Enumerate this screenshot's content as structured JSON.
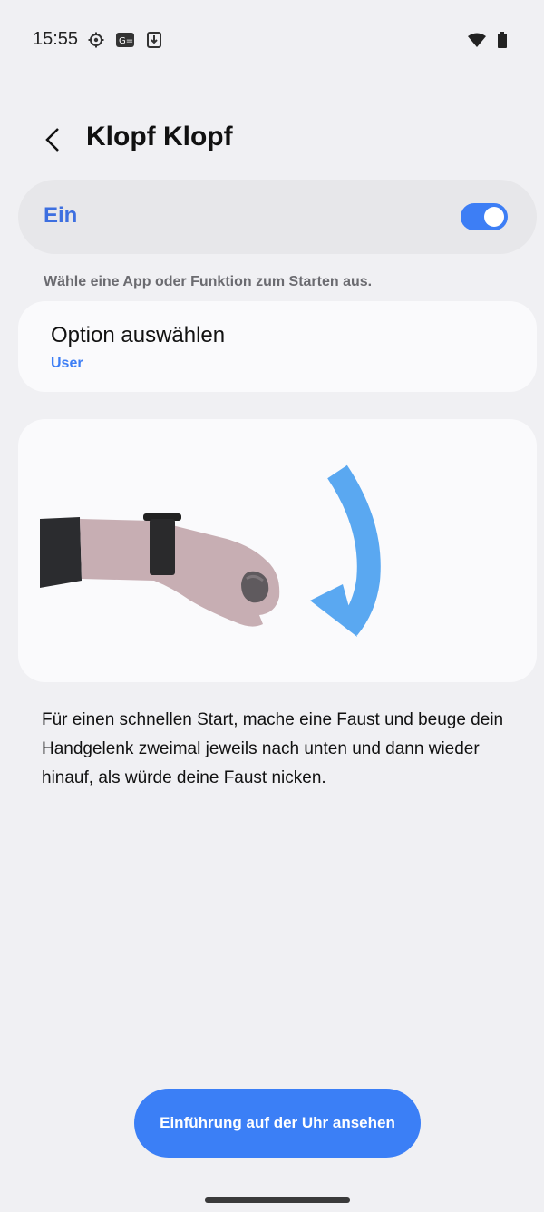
{
  "status_bar": {
    "time": "15:55",
    "icons_left": [
      "settings-gear-icon",
      "g-badge-icon",
      "download-icon"
    ],
    "icons_right": [
      "wifi-icon",
      "battery-icon"
    ]
  },
  "header": {
    "back_icon": "chevron-left-icon",
    "title": "Klopf Klopf"
  },
  "toggle": {
    "label": "Ein",
    "state": "on",
    "accent_color": "#3d7ef5"
  },
  "helper": {
    "text": "Wähle eine App oder Funktion zum Starten aus."
  },
  "option": {
    "title": "Option auswählen",
    "value": "User"
  },
  "illustration": {
    "name": "wrist-knock-gesture-illustration"
  },
  "description": {
    "text": "Für einen schnellen Start, mache eine Faust und beuge dein Handgelenk zweimal jeweils nach unten und dann wieder hinauf, als würde deine Faust nicken."
  },
  "cta": {
    "label": "Einführung auf der Uhr ansehen",
    "color": "#3b7ff6"
  }
}
